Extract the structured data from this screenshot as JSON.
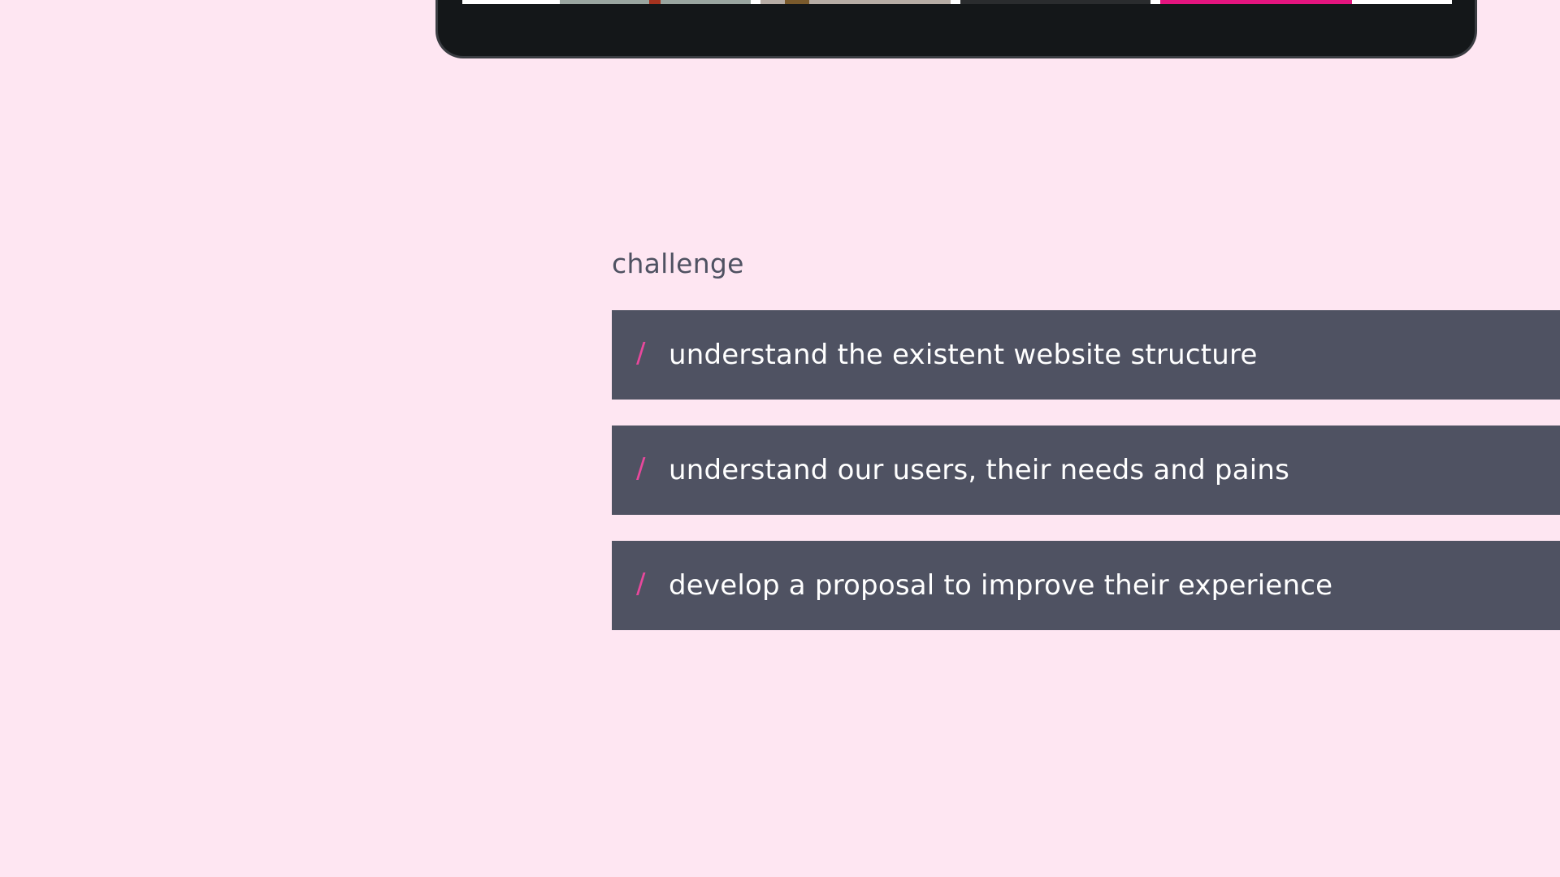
{
  "theme": {
    "background": "#fee6f2",
    "panel": "#4f5262",
    "accent": "#e8489c",
    "device_frame": "#141719"
  },
  "challenge": {
    "title": "challenge",
    "bullet_icon": "slash-icon",
    "bullet_glyph": "/",
    "items": [
      {
        "text": "understand the existent website structure"
      },
      {
        "text": "understand our users, their needs and pains"
      },
      {
        "text": "develop a proposal to improve their experience"
      }
    ]
  }
}
